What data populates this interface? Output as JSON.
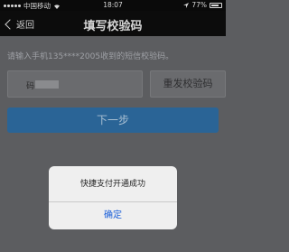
{
  "status_bar": {
    "carrier": "中国移动",
    "time": "18:07",
    "battery_percent": "77%"
  },
  "nav": {
    "back_label": "返回",
    "title": "填写校验码"
  },
  "hint": "请输入手机135****2005收到的短信校验码。",
  "code_input": {
    "value_prefix": "码"
  },
  "resend_label": "重发校验码",
  "next_label": "下一步",
  "dialog": {
    "message": "快捷支付开通成功",
    "ok_label": "确定"
  }
}
